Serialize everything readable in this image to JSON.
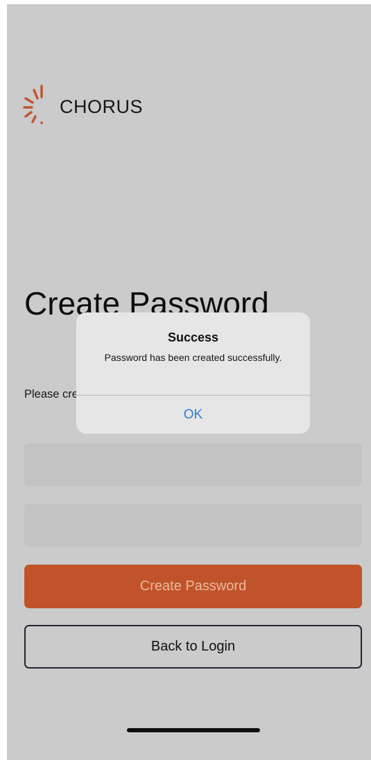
{
  "app": {
    "brand": "CHORUS",
    "icon": "chorus-logo-icon"
  },
  "page": {
    "heading": "Create Password",
    "instructions": "Please create a password for your account."
  },
  "form": {
    "password_value": "",
    "confirm_value": ""
  },
  "buttons": {
    "create": "Create Password",
    "back": "Back to Login"
  },
  "alert": {
    "title": "Success",
    "message": "Password has been created successfully.",
    "ok": "OK"
  },
  "colors": {
    "accent": "#c1532a",
    "link": "#2e7bd0",
    "background": "#cbcbcb"
  }
}
